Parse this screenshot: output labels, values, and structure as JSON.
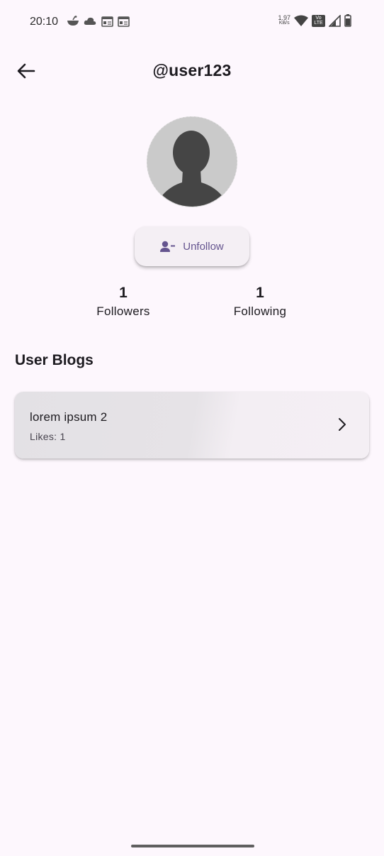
{
  "status_bar": {
    "time": "20:10",
    "net_speed_value": "1.97",
    "net_speed_unit": "KB/s",
    "volte_line1": "Vo",
    "volte_line2": "LTE",
    "left_icons": [
      "notification-app-icon",
      "cloud-icon",
      "news-icon",
      "news-icon"
    ],
    "right_icons": [
      "wifi-icon",
      "volte-icon",
      "signal-icon",
      "battery-icon"
    ]
  },
  "app_bar": {
    "title": "@user123",
    "back_icon": "arrow-left-icon"
  },
  "profile": {
    "avatar_icon": "person-silhouette-icon",
    "unfollow_label": "Unfollow",
    "unfollow_icon": "person-remove-icon",
    "accent_color": "#65558f"
  },
  "stats": {
    "followers_count": "1",
    "followers_label": "Followers",
    "following_count": "1",
    "following_label": "Following"
  },
  "blogs": {
    "section_title": "User Blogs",
    "items": [
      {
        "title": "lorem ipsum 2",
        "likes": "Likes: 1",
        "icon": "chevron-right-icon"
      }
    ]
  }
}
